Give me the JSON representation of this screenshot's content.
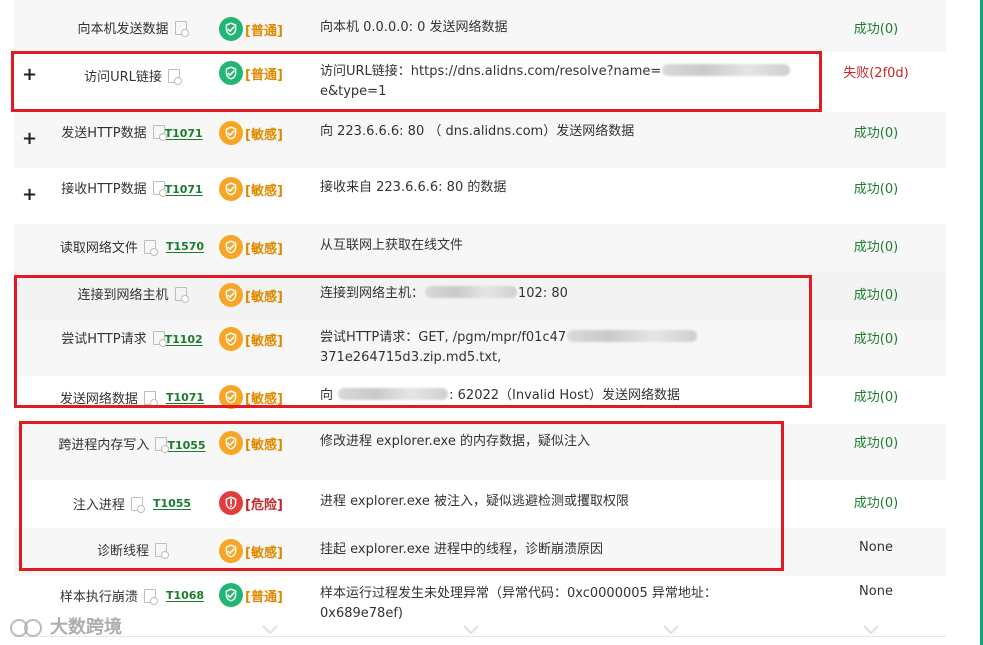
{
  "rows": [
    {
      "id": "row-0",
      "expand": false,
      "name": "向本机发送数据",
      "technique": "",
      "technique_position": "none",
      "risk": {
        "level": "普通",
        "color": "green"
      },
      "description": [
        {
          "t": "text",
          "v": "向本机 0.0.0.0: 0 发送网络数据"
        }
      ],
      "status": {
        "text": "成功(0)",
        "type": "ok"
      }
    },
    {
      "id": "row-1",
      "expand": true,
      "name": "访问URL链接",
      "technique": "",
      "technique_position": "none",
      "risk": {
        "level": "普通",
        "color": "green"
      },
      "description": [
        {
          "t": "text",
          "v": "访问URL链接：https://dns.alidns.com/resolve?name="
        },
        {
          "t": "blur"
        },
        {
          "t": "text",
          "v": "e&type=1"
        }
      ],
      "status": {
        "text": "失败(2f0d)",
        "type": "fail"
      }
    },
    {
      "id": "row-2",
      "expand": true,
      "name": "发送HTTP数据",
      "technique": "T1071",
      "technique_position": "below",
      "risk": {
        "level": "敏感",
        "color": "orange"
      },
      "description": [
        {
          "t": "text",
          "v": "向 223.6.6.6: 80 （ dns.alidns.com）发送网络数据"
        }
      ],
      "status": {
        "text": "成功(0)",
        "type": "ok"
      }
    },
    {
      "id": "row-3",
      "expand": true,
      "name": "接收HTTP数据",
      "technique": "T1071",
      "technique_position": "below",
      "risk": {
        "level": "敏感",
        "color": "orange"
      },
      "description": [
        {
          "t": "text",
          "v": "接收来自 223.6.6.6: 80 的数据"
        }
      ],
      "status": {
        "text": "成功(0)",
        "type": "ok"
      }
    },
    {
      "id": "row-4",
      "expand": false,
      "name": "读取网络文件",
      "technique": "T1570",
      "technique_position": "inline",
      "risk": {
        "level": "敏感",
        "color": "orange"
      },
      "description": [
        {
          "t": "text",
          "v": "从互联网上获取在线文件"
        }
      ],
      "status": {
        "text": "成功(0)",
        "type": "ok"
      }
    },
    {
      "id": "row-5",
      "expand": false,
      "name": "连接到网络主机",
      "technique": "",
      "technique_position": "none",
      "risk": {
        "level": "敏感",
        "color": "orange"
      },
      "description": [
        {
          "t": "text",
          "v": "连接到网络主机："
        },
        {
          "t": "blur"
        },
        {
          "t": "text",
          "v": "102: 80"
        }
      ],
      "status": {
        "text": "成功(0)",
        "type": "ok"
      }
    },
    {
      "id": "row-6",
      "expand": false,
      "name": "尝试HTTP请求",
      "technique": "T1102",
      "technique_position": "below",
      "risk": {
        "level": "敏感",
        "color": "orange"
      },
      "description": [
        {
          "t": "text",
          "v": "尝试HTTP请求：GET, /pgm/mpr/f01c47"
        },
        {
          "t": "blur"
        },
        {
          "t": "text",
          "v": "371e264715d3.zip.md5.txt,"
        }
      ],
      "status": {
        "text": "成功(0)",
        "type": "ok"
      }
    },
    {
      "id": "row-7",
      "expand": false,
      "name": "发送网络数据",
      "technique": "T1071",
      "technique_position": "inline",
      "risk": {
        "level": "敏感",
        "color": "orange"
      },
      "description": [
        {
          "t": "text",
          "v": "向 "
        },
        {
          "t": "blur"
        },
        {
          "t": "text",
          "v": ": 62022（Invalid Host）发送网络数据"
        }
      ],
      "status": {
        "text": "成功(0)",
        "type": "ok"
      }
    },
    {
      "id": "row-8",
      "expand": false,
      "name": "跨进程内存写入",
      "technique": "T1055",
      "technique_position": "below",
      "risk": {
        "level": "敏感",
        "color": "orange"
      },
      "description": [
        {
          "t": "text",
          "v": "修改进程 explorer.exe 的内存数据，疑似注入"
        }
      ],
      "status": {
        "text": "成功(0)",
        "type": "ok"
      }
    },
    {
      "id": "row-9",
      "expand": false,
      "name": "注入进程",
      "technique": "T1055",
      "technique_position": "inline",
      "risk": {
        "level": "危险",
        "color": "red"
      },
      "description": [
        {
          "t": "text",
          "v": "进程 explorer.exe 被注入，疑似逃避检测或攫取权限"
        }
      ],
      "status": {
        "text": "成功(0)",
        "type": "ok"
      }
    },
    {
      "id": "row-10",
      "expand": false,
      "name": "诊断线程",
      "technique": "",
      "technique_position": "none",
      "risk": {
        "level": "敏感",
        "color": "orange"
      },
      "description": [
        {
          "t": "text",
          "v": "挂起 explorer.exe 进程中的线程，诊断崩溃原因"
        }
      ],
      "status": {
        "text": "None",
        "type": "none"
      }
    },
    {
      "id": "row-11",
      "expand": false,
      "name": "样本执行崩溃",
      "technique": "T1068",
      "technique_position": "inline",
      "risk": {
        "level": "普通",
        "color": "green"
      },
      "description": [
        {
          "t": "text",
          "v": "样本运行过程发生未处理异常（异常代码：0xc0000005 异常地址：0x689e78ef)"
        }
      ],
      "status": {
        "text": "None",
        "type": "none"
      }
    }
  ],
  "watermark": {
    "text": "大数跨境"
  },
  "colors": {
    "highlight_border": "#e01b24",
    "ok": "#1b7d2c",
    "fail": "#c62828",
    "sidebar": "#14a37a"
  }
}
